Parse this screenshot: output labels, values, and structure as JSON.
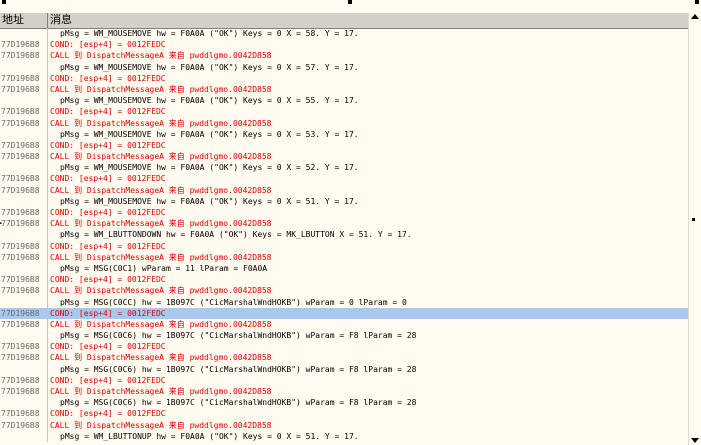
{
  "header": {
    "address_label": "地址",
    "message_label": "消息"
  },
  "rows": [
    {
      "addr": "",
      "text": "pMsg = WM_MOUSEMOVE hw = F0A0A (\"OK\") Keys = 0 X = 58. Y = 17.",
      "kind": "msg"
    },
    {
      "addr": "77D196B8",
      "text": "COND: [esp+4] = 0012FEDC",
      "kind": "cond"
    },
    {
      "addr": "77D196B8",
      "text": "CALL 到 DispatchMessageA 来自 pwddlgmo.0042D858",
      "kind": "call"
    },
    {
      "addr": "",
      "text": "pMsg = WM_MOUSEMOVE hw = F0A0A (\"OK\") Keys = 0 X = 57. Y = 17.",
      "kind": "msg"
    },
    {
      "addr": "77D196B8",
      "text": "COND: [esp+4] = 0012FEDC",
      "kind": "cond"
    },
    {
      "addr": "77D196B8",
      "text": "CALL 到 DispatchMessageA 来自 pwddlgmo.0042D858",
      "kind": "call"
    },
    {
      "addr": "",
      "text": "pMsg = WM_MOUSEMOVE hw = F0A0A (\"OK\") Keys = 0 X = 55. Y = 17.",
      "kind": "msg"
    },
    {
      "addr": "77D196B8",
      "text": "COND: [esp+4] = 0012FEDC",
      "kind": "cond"
    },
    {
      "addr": "77D196B8",
      "text": "CALL 到 DispatchMessageA 来自 pwddlgmo.0042D858",
      "kind": "call"
    },
    {
      "addr": "",
      "text": "pMsg = WM_MOUSEMOVE hw = F0A0A (\"OK\") Keys = 0 X = 53. Y = 17.",
      "kind": "msg"
    },
    {
      "addr": "77D196B8",
      "text": "COND: [esp+4] = 0012FEDC",
      "kind": "cond"
    },
    {
      "addr": "77D196B8",
      "text": "CALL 到 DispatchMessageA 来自 pwddlgmo.0042D858",
      "kind": "call"
    },
    {
      "addr": "",
      "text": "pMsg = WM_MOUSEMOVE hw = F0A0A (\"OK\") Keys = 0 X = 52. Y = 17.",
      "kind": "msg"
    },
    {
      "addr": "77D196B8",
      "text": "COND: [esp+4] = 0012FEDC",
      "kind": "cond"
    },
    {
      "addr": "77D196B8",
      "text": "CALL 到 DispatchMessageA 来自 pwddlgmo.0042D858",
      "kind": "call"
    },
    {
      "addr": "",
      "text": "pMsg = WM_MOUSEMOVE hw = F0A0A (\"OK\") Keys = 0 X = 51. Y = 17.",
      "kind": "msg"
    },
    {
      "addr": "77D196B8",
      "text": "COND: [esp+4] = 0012FEDC",
      "kind": "cond"
    },
    {
      "addr": "77D196B8",
      "text": "CALL 到 DispatchMessageA 来自 pwddlgmo.0042D858",
      "kind": "call",
      "marker": true
    },
    {
      "addr": "",
      "text": "pMsg = WM_LBUTTONDOWN hw = F0A0A (\"OK\") Keys = MK_LBUTTON X = 51. Y = 17.",
      "kind": "msg"
    },
    {
      "addr": "77D196B8",
      "text": "COND: [esp+4] = 0012FEDC",
      "kind": "cond"
    },
    {
      "addr": "77D196B8",
      "text": "CALL 到 DispatchMessageA 来自 pwddlgmo.0042D858",
      "kind": "call"
    },
    {
      "addr": "",
      "text": "pMsg = MSG(C0C1) wParam = 11 lParam = F0A0A",
      "kind": "msg"
    },
    {
      "addr": "77D196B8",
      "text": "COND: [esp+4] = 0012FEDC",
      "kind": "cond"
    },
    {
      "addr": "77D196B8",
      "text": "CALL 到 DispatchMessageA 来自 pwddlgmo.0042D858",
      "kind": "call"
    },
    {
      "addr": "",
      "text": "pMsg = MSG(C0CC) hw = 1B097C (\"CicMarshalWndHOKB\") wParam = 0 lParam = 0",
      "kind": "msg"
    },
    {
      "addr": "77D196B8",
      "text": "COND: [esp+4] = 0012FEDC",
      "kind": "cond",
      "selected": true
    },
    {
      "addr": "77D196B8",
      "text": "CALL 到 DispatchMessageA 来自 pwddlgmo.0042D858",
      "kind": "call"
    },
    {
      "addr": "",
      "text": "pMsg = MSG(C0C6) hw = 1B097C (\"CicMarshalWndHOKB\") wParam = F8 lParam = 28",
      "kind": "msg"
    },
    {
      "addr": "77D196B8",
      "text": "COND: [esp+4] = 0012FEDC",
      "kind": "cond"
    },
    {
      "addr": "77D196B8",
      "text": "CALL 到 DispatchMessageA 来自 pwddlgmo.0042D858",
      "kind": "call"
    },
    {
      "addr": "",
      "text": "pMsg = MSG(C0C6) hw = 1B097C (\"CicMarshalWndHOKB\") wParam = F8 lParam = 28",
      "kind": "msg"
    },
    {
      "addr": "77D196B8",
      "text": "COND: [esp+4] = 0012FEDC",
      "kind": "cond"
    },
    {
      "addr": "77D196B8",
      "text": "CALL 到 DispatchMessageA 来自 pwddlgmo.0042D858",
      "kind": "call"
    },
    {
      "addr": "",
      "text": "pMsg = MSG(C0C6) hw = 1B097C (\"CicMarshalWndHOKB\") wParam = F8 lParam = 28",
      "kind": "msg"
    },
    {
      "addr": "77D196B8",
      "text": "COND: [esp+4] = 0012FEDC",
      "kind": "cond"
    },
    {
      "addr": "77D196B8",
      "text": "CALL 到 DispatchMessageA 来自 pwddlgmo.0042D858",
      "kind": "call"
    },
    {
      "addr": "",
      "text": "pMsg = WM_LBUTTONUP hw = F0A0A (\"OK\") Keys = 0 X = 51. Y = 17.",
      "kind": "msg"
    }
  ],
  "colors": {
    "call": "#e00000",
    "cond": "#e00000",
    "selected_bg": "#a8c8f0",
    "address": "#6a6a6a"
  },
  "icons": {
    "scroll_up": "triangle-up",
    "scroll_down": "triangle-down",
    "row_marker": "arrow-right"
  }
}
